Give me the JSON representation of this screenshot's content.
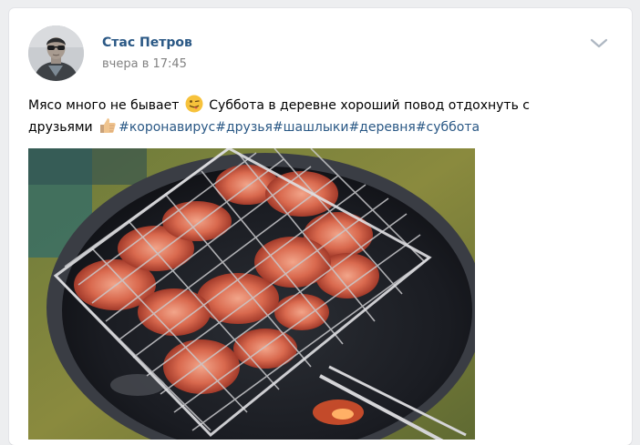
{
  "post": {
    "author": "Стас Петров",
    "date": "вчера в 17:45",
    "text_line1": "Мясо много не бывает",
    "text_line1_cont": "Суббота в деревне хороший повод отдохнуть с",
    "text_line2": "друзьями",
    "hashtags": [
      "#коронавирус",
      "#друзья",
      "#шашлыки",
      "#деревня",
      "#суббота"
    ],
    "emoji_1": "winking-tongue-emoji",
    "emoji_2": "thumbs-up-emoji"
  },
  "icons": {
    "menu": "chevron-down-icon"
  },
  "colors": {
    "page_bg": "#edeef0",
    "card_bg": "#ffffff",
    "link": "#2a5885",
    "meta": "#828282",
    "text": "#000000"
  }
}
